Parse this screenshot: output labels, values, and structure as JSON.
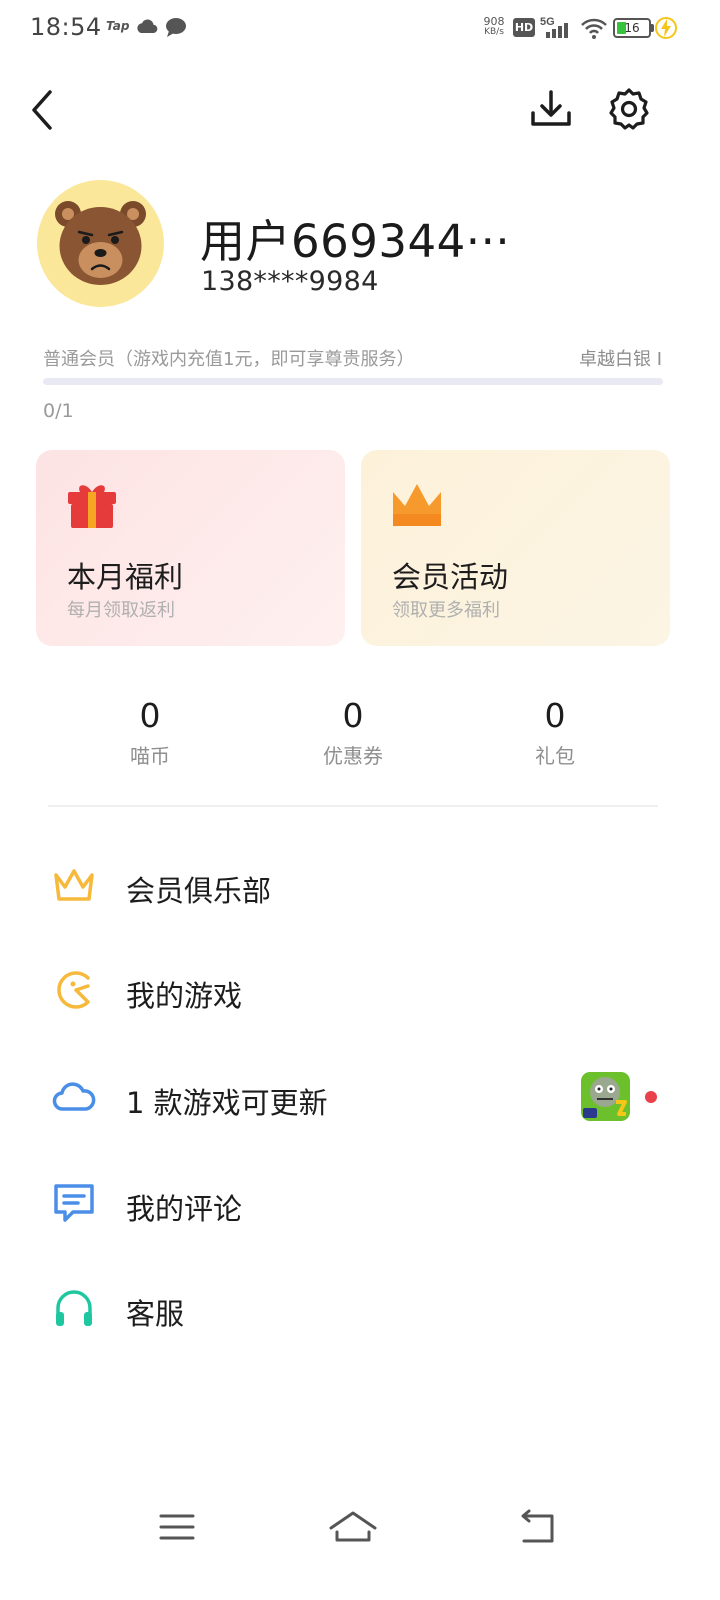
{
  "status_bar": {
    "time": "18:54",
    "tap_label": "Tap",
    "net_speed_value": "908",
    "net_speed_unit": "KB/s",
    "hd_label": "HD",
    "network_label": "5G",
    "battery_level": "16",
    "colors": {
      "battery": "#37c43c",
      "charge": "#f5c518"
    }
  },
  "profile": {
    "username": "用户669344···",
    "phone": "138****9984"
  },
  "membership": {
    "level_text": "普通会员（游戏内充值1元，即可享尊贵服务）",
    "next_level": "卓越白银 I",
    "progress_text": "0/1",
    "progress_fraction": 0.0,
    "accent_color": "#7a86f5"
  },
  "cards": {
    "welfare": {
      "title": "本月福利",
      "subtitle": "每月领取返利",
      "icon": "gift-icon",
      "color": "#e63b3b"
    },
    "activity": {
      "title": "会员活动",
      "subtitle": "领取更多福利",
      "icon": "crown-icon",
      "color": "#f79a2e"
    }
  },
  "stats": [
    {
      "value": "0",
      "label": "喵币"
    },
    {
      "value": "0",
      "label": "优惠券"
    },
    {
      "value": "0",
      "label": "礼包"
    }
  ],
  "menu": [
    {
      "label": "会员俱乐部",
      "icon": "crown-outline-icon",
      "color": "#f6b93b"
    },
    {
      "label": "我的游戏",
      "icon": "pacman-icon",
      "color": "#f6b93b"
    },
    {
      "label": "1 款游戏可更新",
      "icon": "cloud-icon",
      "color": "#4a8ee8"
    },
    {
      "label": "我的评论",
      "icon": "comment-icon",
      "color": "#4a8ee8"
    },
    {
      "label": "客服",
      "icon": "headphones-icon",
      "color": "#1ec7a0"
    }
  ],
  "nav": [
    "menu-icon",
    "home-icon",
    "back-icon"
  ]
}
